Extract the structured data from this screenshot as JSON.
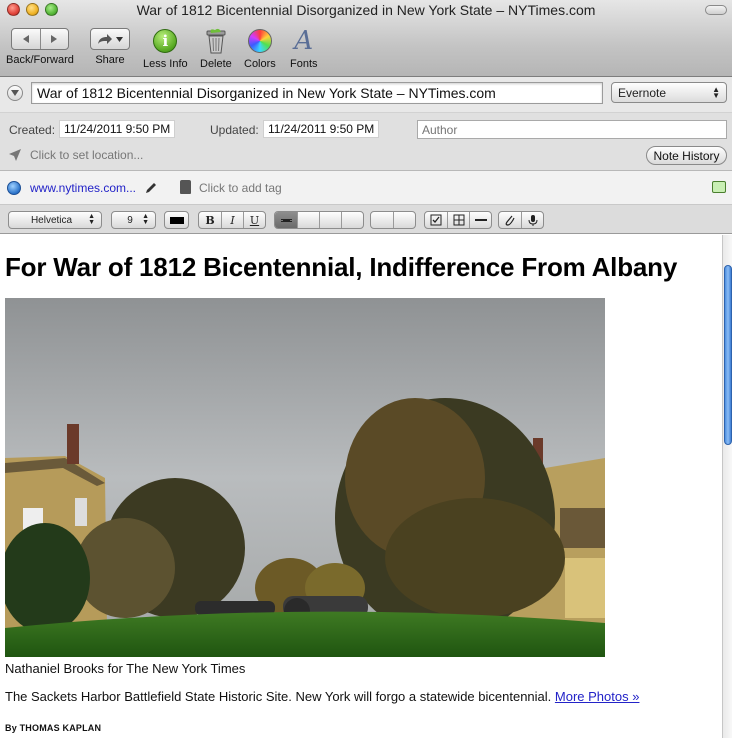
{
  "window": {
    "title": "War of 1812 Bicentennial Disorganized in New York State – NYTimes.com"
  },
  "toolbar": {
    "items": [
      {
        "label": "Back/Forward",
        "icon": "back-forward-icon"
      },
      {
        "label": "Share",
        "icon": "share-icon"
      },
      {
        "label": "Less Info",
        "icon": "info-icon"
      },
      {
        "label": "Delete",
        "icon": "trash-icon"
      },
      {
        "label": "Colors",
        "icon": "color-wheel-icon"
      },
      {
        "label": "Fonts",
        "icon": "fonts-icon"
      }
    ],
    "info_glyph": "i",
    "fonts_glyph": "A"
  },
  "note": {
    "title_value": "War of 1812 Bicentennial Disorganized in New York State – NYTimes.com",
    "notebook": "Evernote",
    "created_label": "Created:",
    "created_value": "11/24/2011   9:50 PM",
    "updated_label": "Updated:",
    "updated_value": "11/24/2011   9:50 PM",
    "author_placeholder": "Author",
    "location_placeholder": "Click to set location...",
    "history_button": "Note History",
    "source_url": "www.nytimes.com...",
    "tag_placeholder": "Click to add tag"
  },
  "format_bar": {
    "font_family": "Helvetica",
    "font_size": "9",
    "bold": "B",
    "italic": "I",
    "underline": "U"
  },
  "article": {
    "headline": "For War of 1812 Bicentennial, Indifference From Albany",
    "photo_credit": "Nathaniel Brooks for The New York Times",
    "summary": "The Sackets Harbor Battlefield State Historic Site. New York will forgo a statewide bicentennial.",
    "more_photos": "More Photos »",
    "byline": "By THOMAS KAPLAN"
  },
  "colors": {
    "link": "#2323c8",
    "scroll_thumb": "#4d8fe0"
  }
}
